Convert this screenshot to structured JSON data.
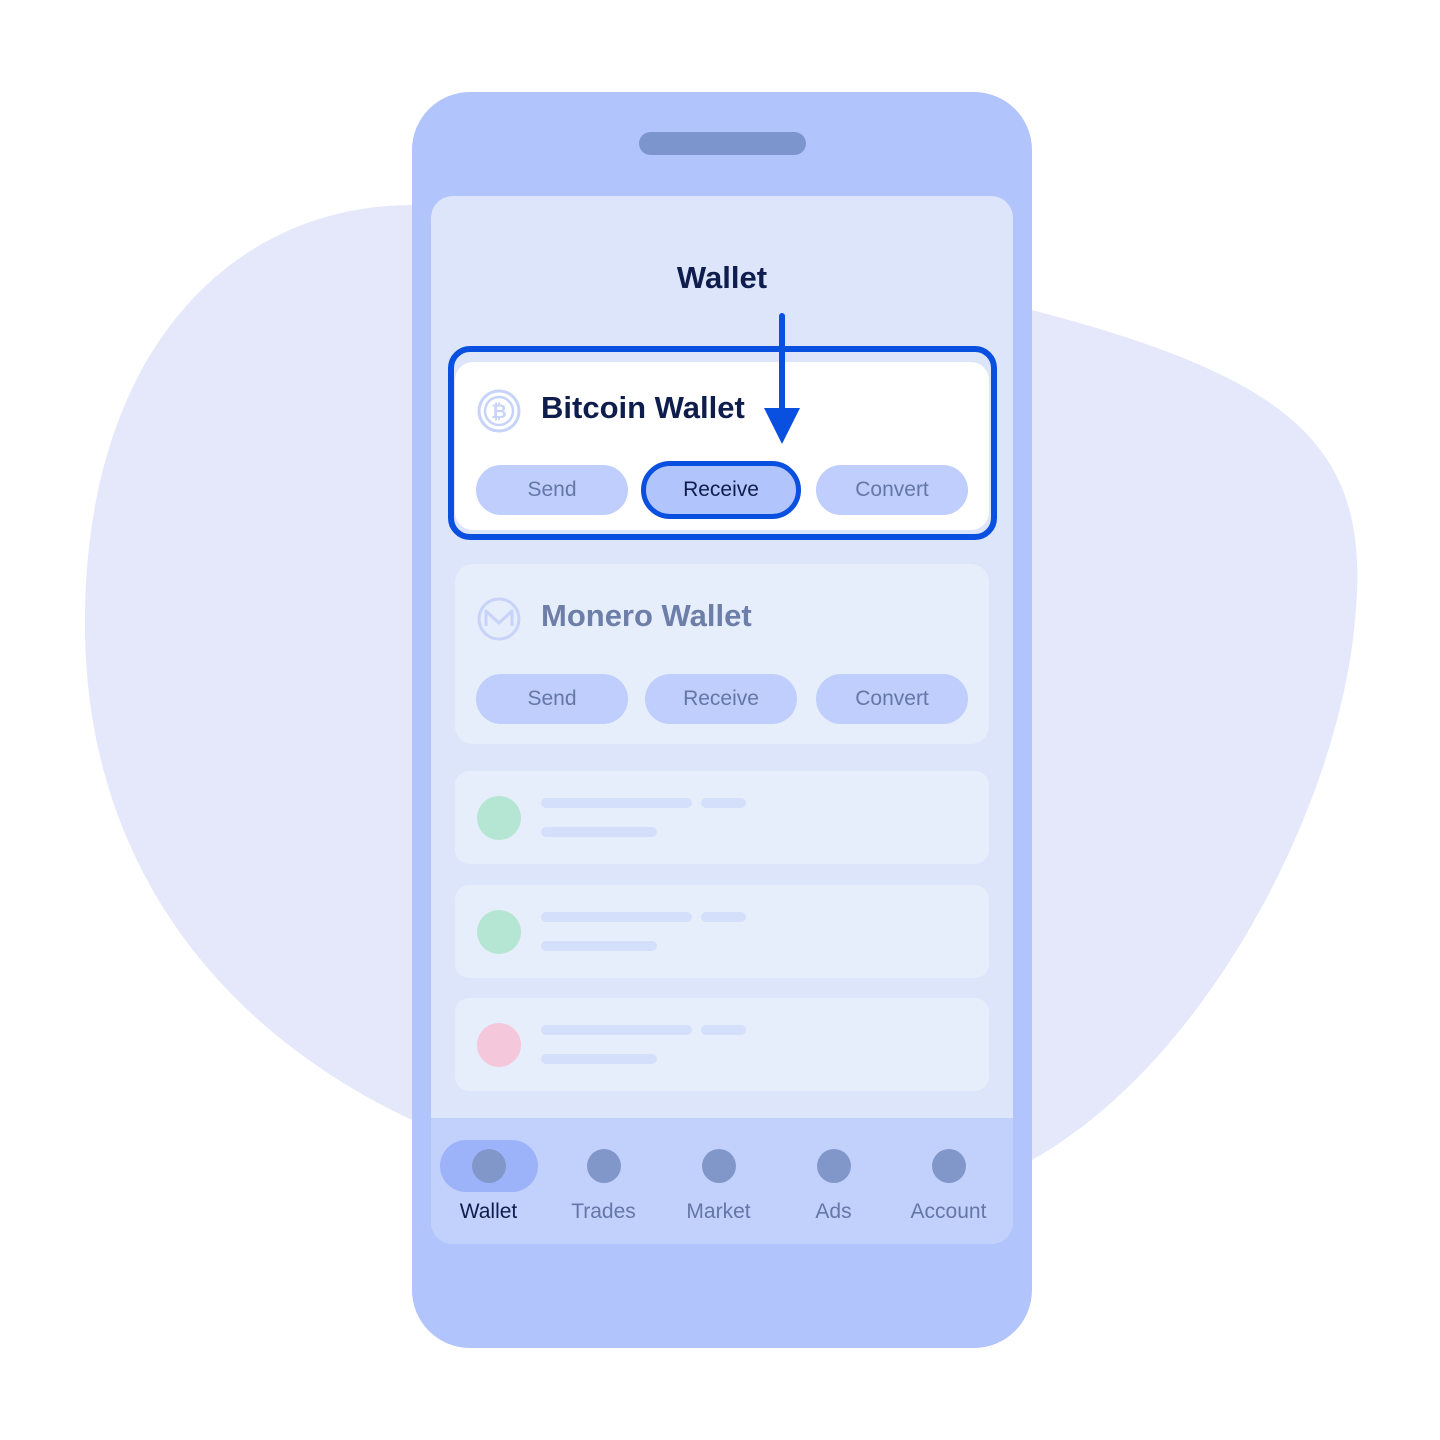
{
  "screen": {
    "title": "Wallet"
  },
  "wallets": [
    {
      "name": "Bitcoin Wallet",
      "icon": "bitcoin-icon",
      "highlighted": true,
      "actions": {
        "send": "Send",
        "receive": "Receive",
        "convert": "Convert"
      }
    },
    {
      "name": "Monero Wallet",
      "icon": "monero-icon",
      "highlighted": false,
      "actions": {
        "send": "Send",
        "receive": "Receive",
        "convert": "Convert"
      }
    }
  ],
  "placeholder_rows": [
    {
      "dot_color": "#b5e6d3"
    },
    {
      "dot_color": "#b5e6d3"
    },
    {
      "dot_color": "#f4c7da"
    }
  ],
  "nav": {
    "items": [
      {
        "label": "Wallet",
        "active": true
      },
      {
        "label": "Trades",
        "active": false
      },
      {
        "label": "Market",
        "active": false
      },
      {
        "label": "Ads",
        "active": false
      },
      {
        "label": "Account",
        "active": false
      }
    ]
  },
  "colors": {
    "accent": "#0950e0",
    "phone": "#b2c4fc",
    "screen": "#dce5fa",
    "text_dark": "#0f1d4d",
    "text_muted": "#6477a8",
    "button": "#bfcefc"
  }
}
